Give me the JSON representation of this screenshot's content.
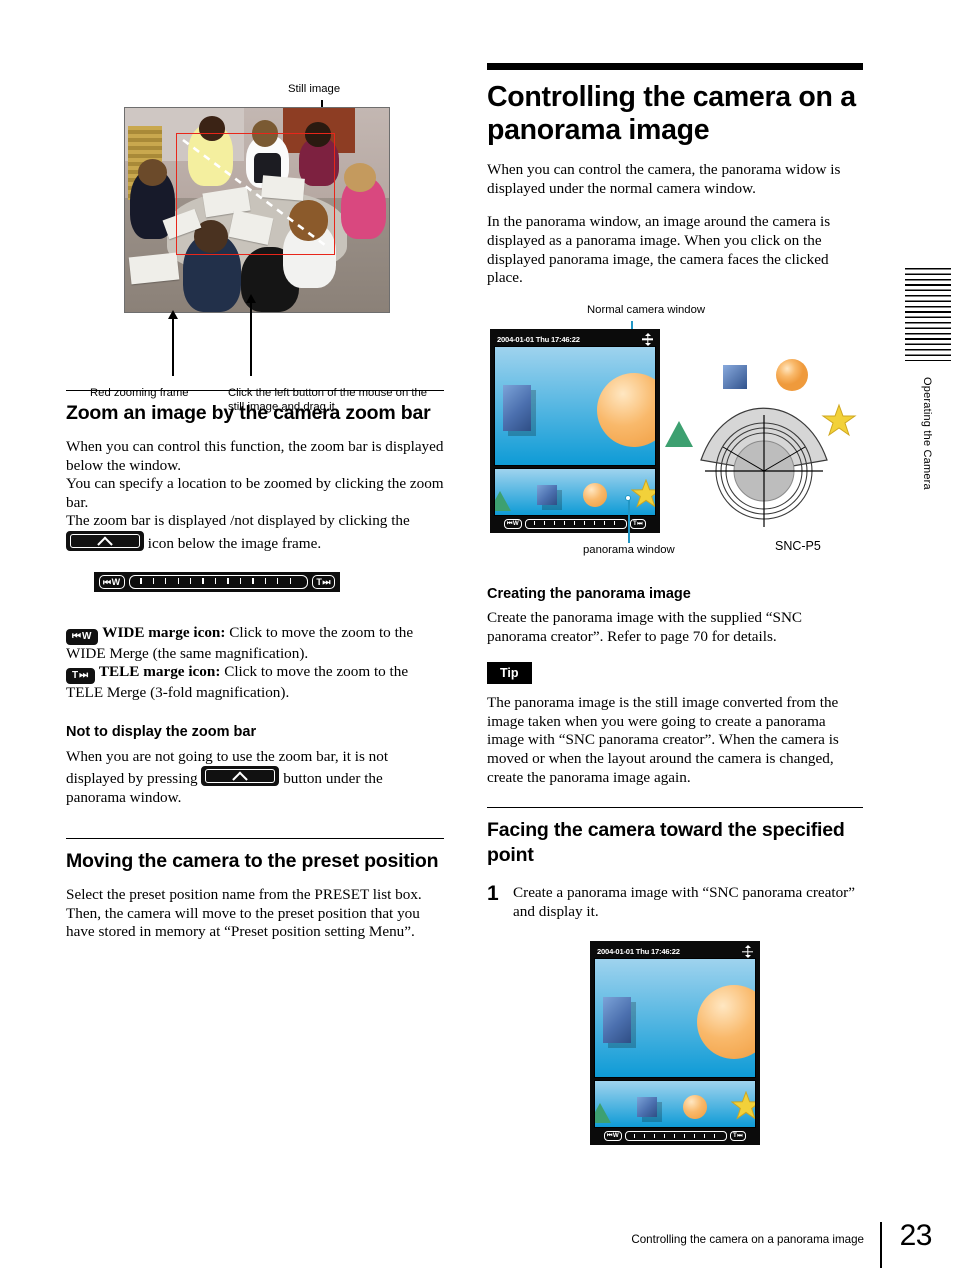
{
  "left_column": {
    "figure_still_image": {
      "top_label": "Still image",
      "bottom_label_left": "Red zooming frame",
      "bottom_label_right": "Click the left button of the mouse on the still image and drag it."
    },
    "section_zoom": {
      "heading": "Zoom an image by the camera zoom bar",
      "para1": "When you can control this function, the zoom bar is displayed below the window.",
      "para2": "You can specify a location to be zoomed by clicking the zoom bar.",
      "para3_before": "The zoom bar is displayed /not displayed by clicking the",
      "para3_after": "icon below the image frame."
    },
    "zoom_bar_figure": {
      "wide_label": "W",
      "tele_label": "T",
      "tick_count": 13
    },
    "icon_defs": {
      "wide_bold": "WIDE marge icon:",
      "wide_rest": "Click to move the zoom to the WIDE Merge (the same magnification).",
      "tele_bold": "TELE marge icon:",
      "tele_rest": "Click to move the zoom to the TELE Merge (3-fold magnification)."
    },
    "section_not_display": {
      "heading": "Not to display the zoom bar",
      "para_before": "When you are not going to use the zoom bar, it is not displayed by pressing",
      "para_after": "button under the panorama window."
    },
    "section_preset": {
      "heading": "Moving the camera to the preset position",
      "para": "Select the preset position name from the PRESET list box.  Then, the camera will move to the preset position that you have stored in memory at “Preset position setting Menu”."
    }
  },
  "right_column": {
    "title": "Controlling the camera on a panorama image",
    "intro_p1": "When you can control the camera, the panorama widow is displayed under the normal camera window.",
    "intro_p2": "In the panorama window, an image around the camera is displayed as a panorama image. When you click on the displayed panorama image, the camera faces the clicked place.",
    "figure_windows": {
      "top_label": "Normal camera window",
      "bottom_label": "panorama window",
      "device_label": "SNC-P5",
      "camera_window": {
        "timestamp": "2004-01-01 Thu 17:46:22",
        "move_icon": "move-cross-icon",
        "wide_label": "W",
        "tele_label": "T",
        "tick_count": 9
      }
    },
    "section_creating": {
      "heading": "Creating the panorama image",
      "para": "Create the panorama image with the supplied “SNC panorama creator”. Refer to page 70 for details."
    },
    "tip": {
      "badge": "Tip",
      "para": "The panorama image is the still image converted from the image taken when you were going to create a panorama image with “SNC panorama creator”. When the camera is moved or when the layout around the camera is changed, create the panorama image again."
    },
    "section_facing": {
      "heading": "Facing the camera toward the specified point",
      "step1_num": "1",
      "step1_text": "Create a panorama image with “SNC panorama creator” and display it.",
      "step1_window": {
        "timestamp": "2004-01-01 Thu 17:46:22",
        "wide_label": "W",
        "tele_label": "T",
        "tick_count": 9
      }
    }
  },
  "side_tab": {
    "label": "Operating the Camera"
  },
  "footer": {
    "running_title": "Controlling the camera on a panorama image",
    "page_number": "23"
  },
  "colors": {
    "red_frame": "#e8261a",
    "callout_blue": "#2196c4",
    "sky_top": "#9fd3ee",
    "sky_bottom": "#0e9bd6",
    "ball_orange": "#f9b96b",
    "cube_blue": "#4b6fae",
    "triangle_green": "#3da070",
    "star_yellow": "#f2d13a"
  }
}
